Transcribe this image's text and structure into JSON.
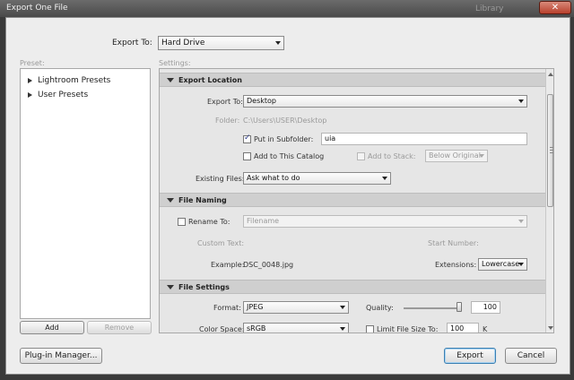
{
  "window": {
    "title": "Export One File",
    "ghost_label": "Library"
  },
  "top": {
    "export_to_label": "Export To:",
    "export_to_value": "Hard Drive"
  },
  "preset": {
    "label": "Preset:",
    "items": [
      {
        "label": "Lightroom Presets"
      },
      {
        "label": "User Presets"
      }
    ],
    "add_label": "Add",
    "remove_label": "Remove"
  },
  "settings": {
    "label": "Settings:",
    "export_location": {
      "header": "Export Location",
      "export_to_label": "Export To:",
      "export_to_value": "Desktop",
      "folder_label": "Folder:",
      "folder_value": "C:\\Users\\USER\\Desktop",
      "subfolder_label": "Put in Subfolder:",
      "subfolder_value": "uia",
      "subfolder_checked": true,
      "add_catalog_label": "Add to This Catalog",
      "add_stack_label": "Add to Stack:",
      "stack_value": "Below Original",
      "existing_files_label": "Existing Files:",
      "existing_files_value": "Ask what to do"
    },
    "file_naming": {
      "header": "File Naming",
      "rename_label": "Rename To:",
      "rename_value": "Filename",
      "custom_text_label": "Custom Text:",
      "start_number_label": "Start Number:",
      "example_label": "Example:",
      "example_value": "DSC_0048.jpg",
      "extensions_label": "Extensions:",
      "extensions_value": "Lowercase"
    },
    "file_settings": {
      "header": "File Settings",
      "format_label": "Format:",
      "format_value": "JPEG",
      "quality_label": "Quality:",
      "quality_value": "100",
      "quality_level": 100,
      "color_space_label": "Color Space:",
      "color_space_value": "sRGB",
      "limit_label": "Limit File Size To:",
      "limit_value": "100",
      "limit_unit": "K"
    }
  },
  "footer": {
    "plugin_label": "Plug-in Manager...",
    "export_label": "Export",
    "cancel_label": "Cancel"
  }
}
